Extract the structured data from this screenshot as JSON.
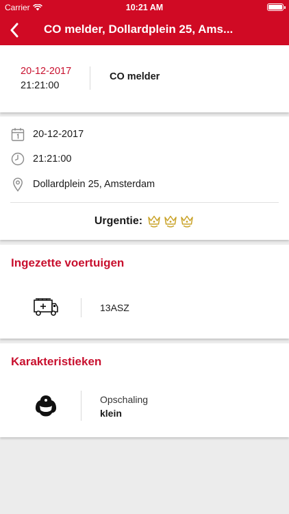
{
  "status_bar": {
    "carrier": "Carrier",
    "time": "10:21 AM"
  },
  "nav": {
    "title": "CO melder, Dollardplein 25, Ams..."
  },
  "summary": {
    "date": "20-12-2017",
    "time": "21:21:00",
    "type": "CO melder"
  },
  "details": {
    "date": "20-12-2017",
    "time": "21:21:00",
    "address": "Dollardplein 25, Amsterdam",
    "urgency_label": "Urgentie:",
    "urgency_level": 3
  },
  "vehicles": {
    "title": "Ingezette voertuigen",
    "items": [
      {
        "code": "13ASZ",
        "icon": "fire-truck-icon"
      }
    ]
  },
  "characteristics": {
    "title": "Karakteristieken",
    "items": [
      {
        "label": "Opschaling",
        "value": "klein",
        "icon": "firefighter-helmet-icon"
      }
    ]
  },
  "colors": {
    "brand_red": "#d00a24",
    "accent_red": "#c8102e",
    "crown_gold": "#c9a227"
  }
}
